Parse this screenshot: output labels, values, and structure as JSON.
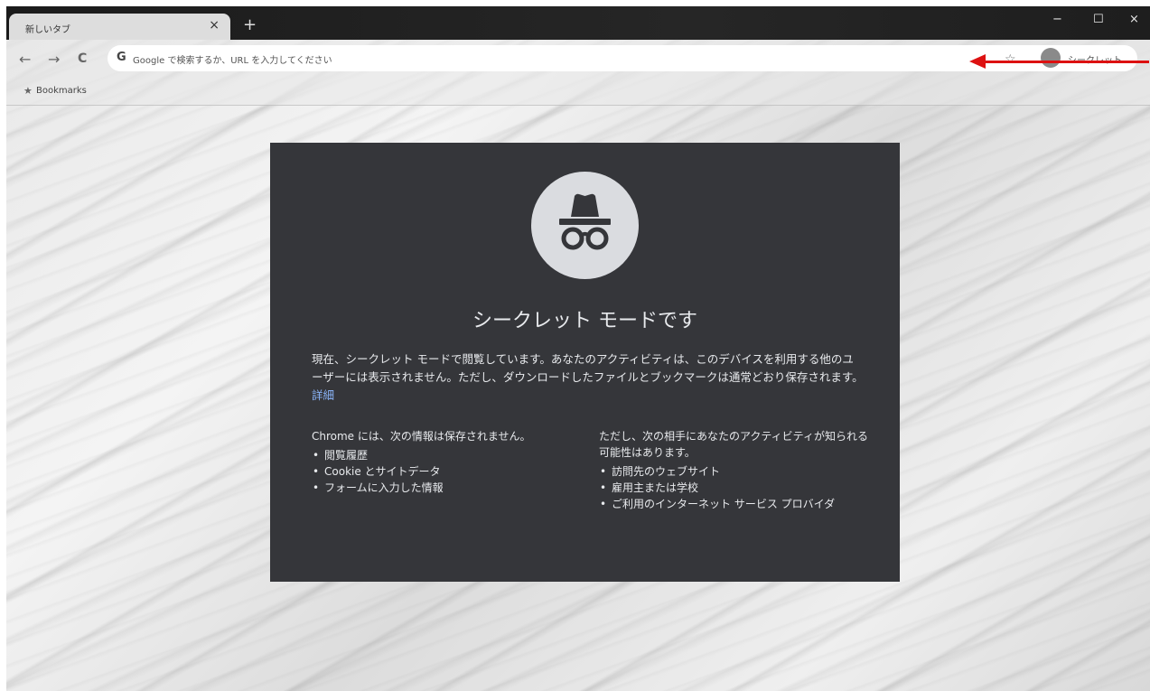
{
  "browser": {
    "tab_title": "新しいタブ",
    "tab_close": "×",
    "new_tab": "+",
    "window_controls": {
      "minimize": "−",
      "maximize": "☐",
      "close": "×"
    }
  },
  "toolbar": {
    "back": "←",
    "forward": "→",
    "reload": "C",
    "omnibox_icon": "G",
    "omnibox_placeholder": "Google で検索するか、URL を入力してください",
    "bookmark_star": "☆",
    "profile_label": "シークレット"
  },
  "bookmarks_bar": {
    "label": "Bookmarks",
    "star": "★"
  },
  "incognito": {
    "title": "シークレット モードです",
    "description": "現在、シークレット モードで閲覧しています。あなたのアクティビティは、このデバイスを利用する他のユーザーには表示されません。ただし、ダウンロードしたファイルとブックマークは通常どおり保存されます。",
    "learn_more": "詳細",
    "not_saved_heading": "Chrome には、次の情報は保存されません。",
    "not_saved_items": [
      "閲覧履歴",
      "Cookie とサイトデータ",
      "フォームに入力した情報"
    ],
    "visible_to_heading": "ただし、次の相手にあなたのアクティビティが知られる可能性はあります。",
    "visible_to_items": [
      "訪問先のウェブサイト",
      "雇用主または学校",
      "ご利用のインターネット サービス プロバイダ"
    ]
  },
  "colors": {
    "card_bg": "#35363a",
    "card_text": "#e8eaed",
    "link": "#8ab4f8",
    "annotation_arrow": "#dd1111"
  }
}
